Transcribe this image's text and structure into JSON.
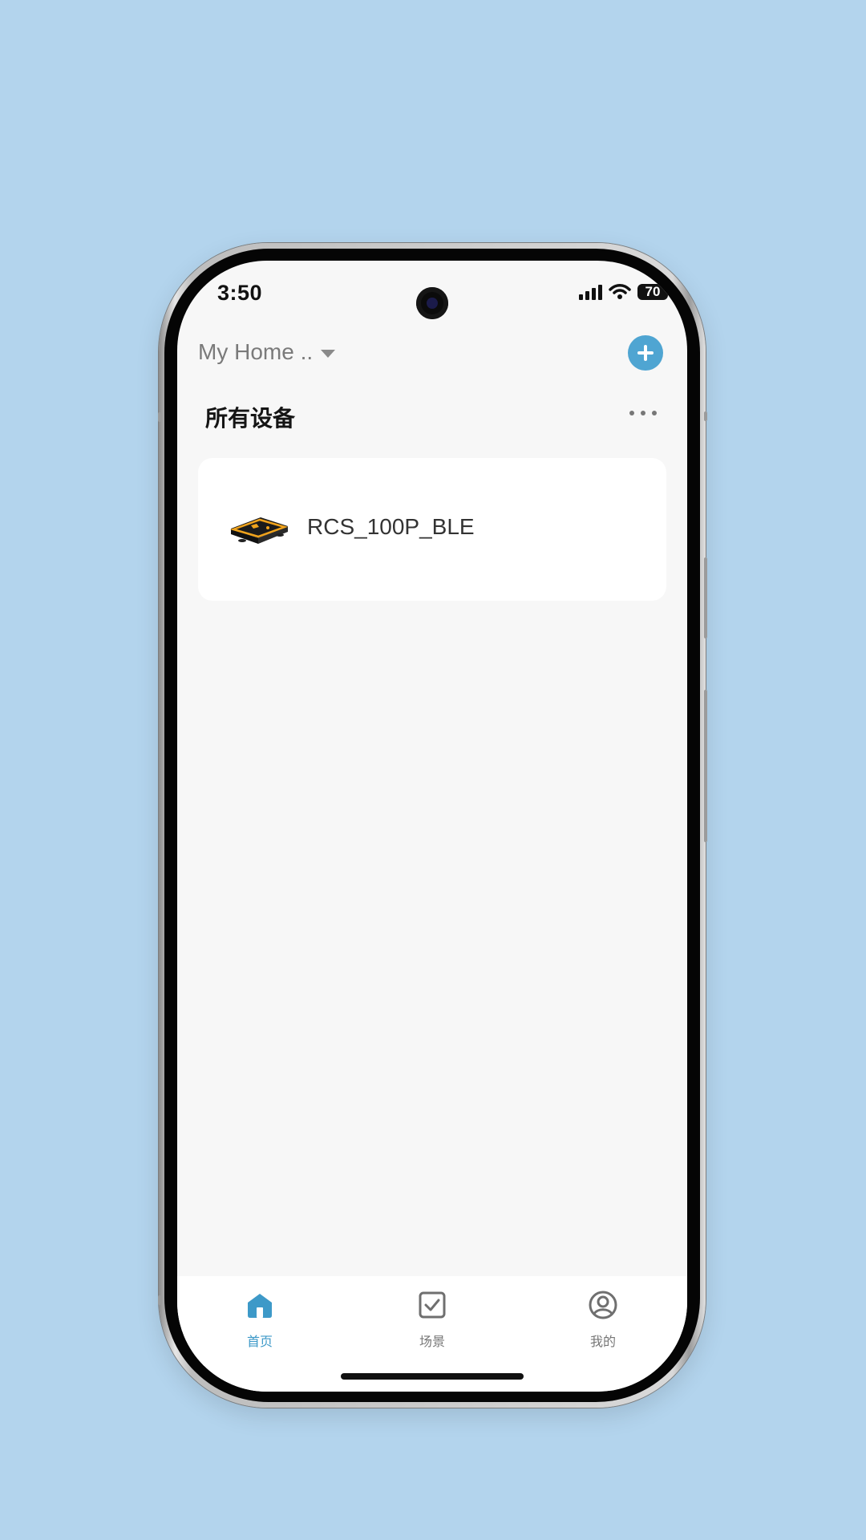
{
  "status_bar": {
    "time": "3:50",
    "battery_level": "70",
    "signal_icon": "cellular-signal-icon",
    "wifi_icon": "wifi-icon"
  },
  "header": {
    "home_label": "My Home ..",
    "dropdown_icon": "chevron-down-icon",
    "add_icon": "plus-icon"
  },
  "section": {
    "title": "所有设备",
    "more_icon": "more-horizontal-icon"
  },
  "devices": [
    {
      "name": "RCS_100P_BLE",
      "image": "device-thumbnail"
    }
  ],
  "bottom_nav": {
    "items": [
      {
        "label": "首页",
        "icon": "home-icon",
        "active": true
      },
      {
        "label": "场景",
        "icon": "checkbox-icon",
        "active": false
      },
      {
        "label": "我的",
        "icon": "user-icon",
        "active": false
      }
    ]
  },
  "colors": {
    "page_background": "#b3d4ed",
    "accent": "#4fa5d2",
    "active_nav": "#3d99c8",
    "screen_background": "#f7f7f7"
  }
}
